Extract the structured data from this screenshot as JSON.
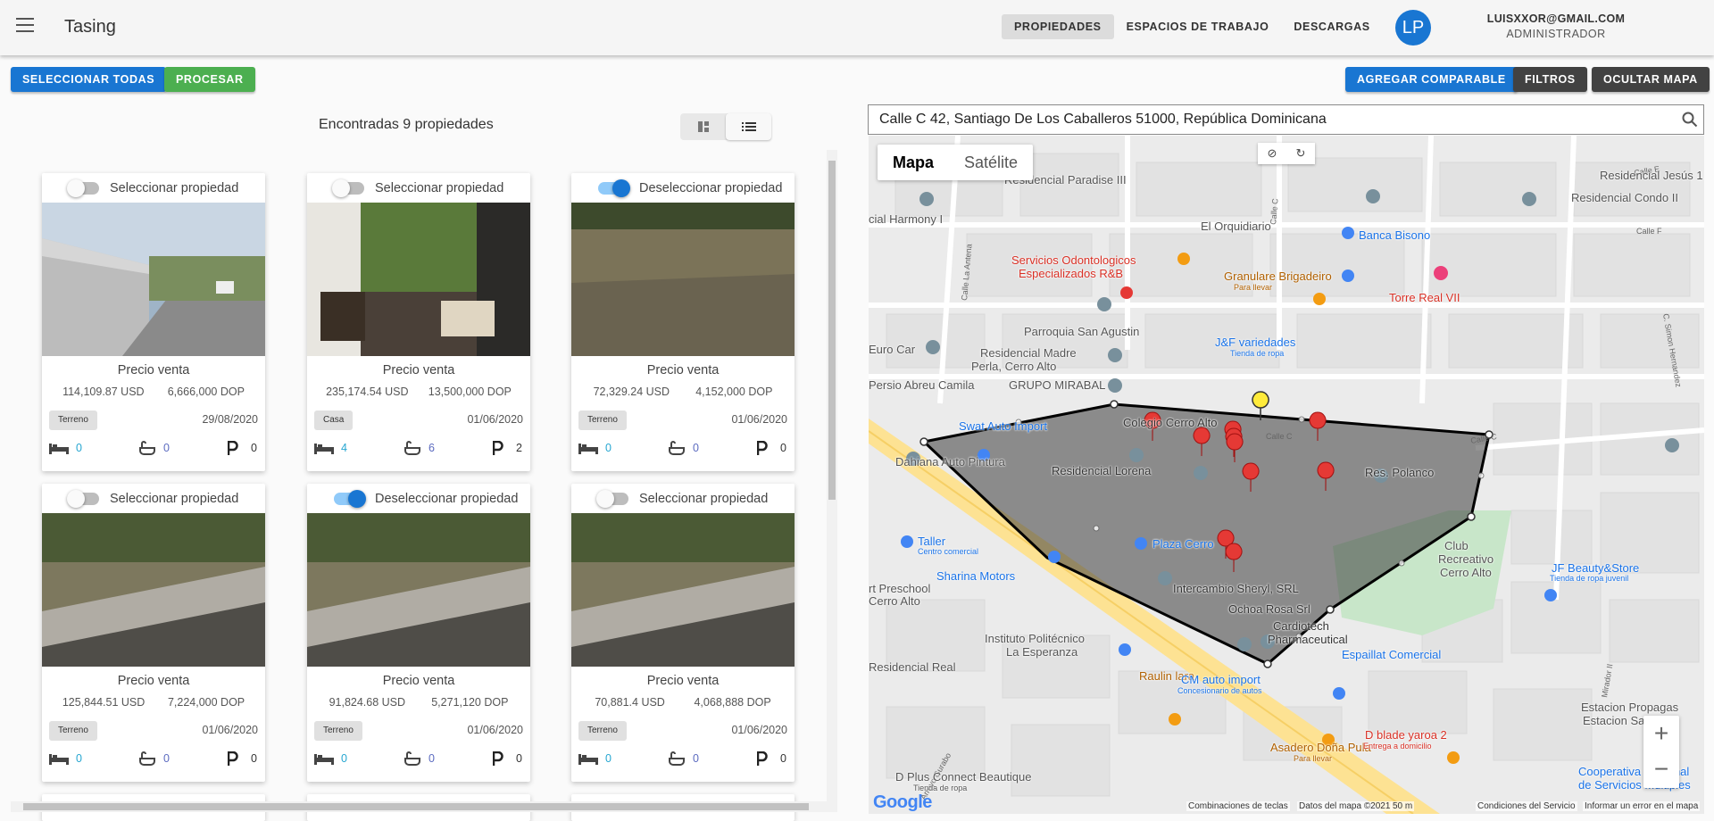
{
  "app": {
    "title": "Tasing"
  },
  "nav": [
    "PROPIEDADES",
    "ESPACIOS DE TRABAJO",
    "DESCARGAS"
  ],
  "user": {
    "initials": "LP",
    "email": "LUISXXOR@GMAIL.COM",
    "role": "ADMINISTRADOR"
  },
  "actions": {
    "select_all": "SELECCIONAR TODAS",
    "process": "PROCESAR",
    "add_comparable": "AGREGAR COMPARABLE",
    "filters": "FILTROS",
    "hide_map": "OCULTAR MAPA"
  },
  "results": {
    "found": "Encontradas 9 propiedades"
  },
  "cards": [
    {
      "toggle": "Seleccionar propiedad",
      "selected": false,
      "price_title": "Precio venta",
      "usd": "114,109.87 USD",
      "dop": "6,666,000 DOP",
      "type": "Terreno",
      "date": "29/08/2020",
      "beds": "0",
      "baths": "0",
      "parking": "0"
    },
    {
      "toggle": "Seleccionar propiedad",
      "selected": false,
      "price_title": "Precio venta",
      "usd": "235,174.54 USD",
      "dop": "13,500,000 DOP",
      "type": "Casa",
      "date": "01/06/2020",
      "beds": "4",
      "baths": "6",
      "parking": "2"
    },
    {
      "toggle": "Deseleccionar propiedad",
      "selected": true,
      "price_title": "Precio venta",
      "usd": "72,329.24 USD",
      "dop": "4,152,000 DOP",
      "type": "Terreno",
      "date": "01/06/2020",
      "beds": "0",
      "baths": "0",
      "parking": "0"
    },
    {
      "toggle": "Seleccionar propiedad",
      "selected": false,
      "price_title": "Precio venta",
      "usd": "125,844.51 USD",
      "dop": "7,224,000 DOP",
      "type": "Terreno",
      "date": "01/06/2020",
      "beds": "0",
      "baths": "0",
      "parking": "0"
    },
    {
      "toggle": "Deseleccionar propiedad",
      "selected": true,
      "price_title": "Precio venta",
      "usd": "91,824.68 USD",
      "dop": "5,271,120 DOP",
      "type": "Terreno",
      "date": "01/06/2020",
      "beds": "0",
      "baths": "0",
      "parking": "0"
    },
    {
      "toggle": "Seleccionar propiedad",
      "selected": false,
      "price_title": "Precio venta",
      "usd": "70,881.4 USD",
      "dop": "4,068,888 DOP",
      "type": "Terreno",
      "date": "01/06/2020",
      "beds": "0",
      "baths": "0",
      "parking": "0"
    }
  ],
  "map": {
    "search_value": "Calle C 42, Santiago De Los Caballeros 51000, República Dominicana",
    "type_map": "Mapa",
    "type_satellite": "Satélite",
    "labels": {
      "residencial_paradise": "Residencial Paradise III",
      "residencial_jesus": "Residencial Jesús 1",
      "residencial_condo": "Residencial Condo II",
      "cial_harmony": "cial Harmony I",
      "el_orquidiario": "El Orquidiario",
      "banca_bisono": "Banca Bisono",
      "servicios_odont_1": "Servicios Odontologicos",
      "servicios_odont_2": "Especializados R&B",
      "granulare": "Granulare Brigadeiro",
      "para_llevar": "Para llevar",
      "torre_real": "Torre Real VII",
      "parroquia": "Parroquia San Agustin",
      "jf_variedades": "J&F variedades",
      "tienda_ropa": "Tienda de ropa",
      "euro_car": "Euro Car",
      "residencial_madre_1": "Residencial Madre",
      "residencial_madre_2": "Perla, Cerro Alto",
      "persio": "Persio Abreu Camila",
      "grupo_mirabal": "GRUPO MIRABAL",
      "colegio": "Colegio Cerro Alto",
      "swat": "Swat Auto Import",
      "dahiana": "Dahiana Auto Pintura",
      "residencial_lorena": "Residencial Lorena",
      "res_polanco": "Res. Polanco",
      "taller": "Taller",
      "centro_comercial": "Centro comercial",
      "plaza_cerro": "Plaza Cerro",
      "sharina": "Sharina Motors",
      "intercambio": "Intercambio Sheryl, SRL",
      "club_1": "Club",
      "club_2": "Recreativo",
      "club_3": "Cerro Alto",
      "jf_beauty": "JF Beauty&Store",
      "tienda_ropa_juvenil": "Tienda de ropa juvenil",
      "ochoa": "Ochoa Rosa Srl",
      "cardiotech_1": "Cardiotech",
      "cardiotech_2": "Pharmaceutical",
      "preschool_1": "rt Preschool",
      "preschool_2": "Cerro Alto",
      "instituto_1": "Instituto Politécnico",
      "instituto_2": "La Esperanza",
      "espaillat": "Espaillat Comercial",
      "residencial_real": "Residencial Real",
      "raulin": "Raulin lara",
      "cm_auto_1": "CM auto import",
      "cm_auto_2": "Concesionario de autos",
      "estacion_1": "Estacion Propagas",
      "estacion_2": "Estacion Sadhalá",
      "asadero": "Asadero Doña Pula",
      "para_llevar_2": "Para llevar",
      "d_blade_1": "D blade yaroa 2",
      "d_blade_2": "Entrega a domicilio",
      "d_plus": "D Plus Connect Beautique",
      "d_plus_2": "Tienda de ropa",
      "cooperativa_1": "Cooperativa Nacional",
      "cooperativa_2": "de Servicios Múltiples",
      "calle_la_antena": "Calle La Antena",
      "calle_c": "Calle C",
      "calle_f": "Calle F",
      "calle_d": "Calle D",
      "calle_e": "Calle E",
      "arroyo_gurabo": "Arroyo Gurabo",
      "c_simon": "C. Simon Hernandez",
      "mirador": "Mirador II"
    },
    "footer": {
      "shortcuts": "Combinaciones de teclas",
      "map_data": "Datos del mapa ©2021",
      "scale": "50 m",
      "terms": "Condiciones del Servicio",
      "report": "Informar un error en el mapa"
    },
    "google": "Google"
  },
  "colors": {
    "primary": "#1976d2",
    "success": "#4caf50",
    "dark": "#424242"
  }
}
